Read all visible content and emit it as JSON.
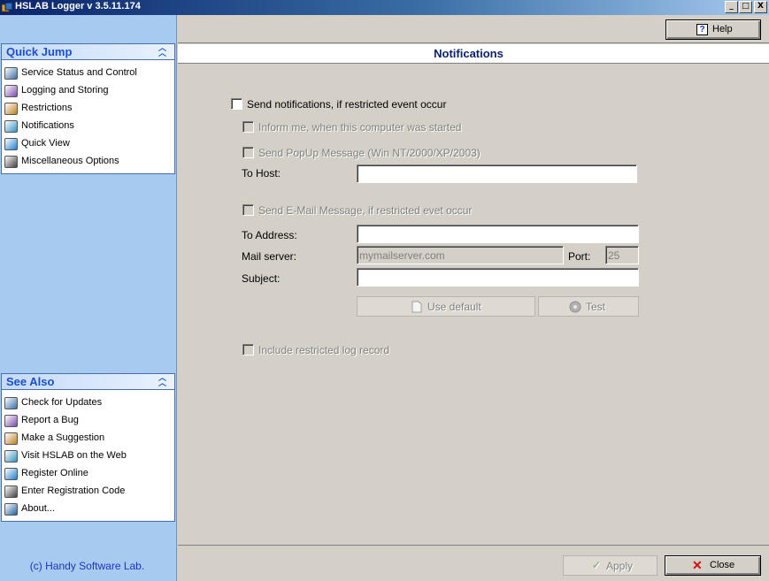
{
  "window": {
    "title": "HSLAB Logger v 3.5.11.174",
    "minimize_glyph": "_",
    "maximize_glyph": "□",
    "close_glyph": "X"
  },
  "quick_jump": {
    "title": "Quick Jump",
    "items": [
      {
        "label": "Service Status and Control",
        "icon": "service-status-icon"
      },
      {
        "label": "Logging and Storing",
        "icon": "logging-icon"
      },
      {
        "label": "Restrictions",
        "icon": "restrictions-icon"
      },
      {
        "label": "Notifications",
        "icon": "notifications-icon"
      },
      {
        "label": "Quick View",
        "icon": "quick-view-icon"
      },
      {
        "label": "Miscellaneous Options",
        "icon": "misc-options-icon"
      }
    ]
  },
  "see_also": {
    "title": "See Also",
    "items": [
      {
        "label": "Check for Updates",
        "icon": "check-updates-icon"
      },
      {
        "label": "Report a Bug",
        "icon": "bug-icon"
      },
      {
        "label": "Make a Suggestion",
        "icon": "suggestion-icon"
      },
      {
        "label": "Visit HSLAB on the Web",
        "icon": "globe-icon"
      },
      {
        "label": "Register Online",
        "icon": "register-icon"
      },
      {
        "label": "Enter Registration Code",
        "icon": "registration-code-icon"
      },
      {
        "label": "About...",
        "icon": "about-icon"
      }
    ]
  },
  "copyright": "(c) Handy Software Lab.",
  "toolbar": {
    "help_label": "Help",
    "help_glyph": "?"
  },
  "page": {
    "title": "Notifications"
  },
  "form": {
    "send_notifications": {
      "label": "Send notifications, if restricted event occur",
      "checked": false
    },
    "inform_started": {
      "label": "Inform me, when this computer was started",
      "checked": false
    },
    "send_popup": {
      "label": "Send PopUp Message (Win NT/2000/XP/2003)",
      "checked": false
    },
    "to_host_label": "To Host:",
    "to_host_value": "",
    "send_email": {
      "label": "Send E-Mail Message, if restricted evet occur",
      "checked": false
    },
    "to_address_label": "To Address:",
    "to_address_value": "",
    "mail_server_label": "Mail server:",
    "mail_server_value": "mymailserver.com",
    "port_label": "Port:",
    "port_value": "25",
    "subject_label": "Subject:",
    "subject_value": "",
    "use_default_label": "Use default",
    "test_label": "Test",
    "include_log": {
      "label": "Include restricted log record",
      "checked": false
    }
  },
  "footer": {
    "apply_label": "Apply",
    "close_label": "Close",
    "apply_glyph": "✓",
    "close_glyph": "✕"
  },
  "colors": {
    "panel_title": "#1c4fcf",
    "page_title": "#0a1f6e",
    "left_background": "#a6caf0",
    "window_face": "#d4d0c8"
  }
}
